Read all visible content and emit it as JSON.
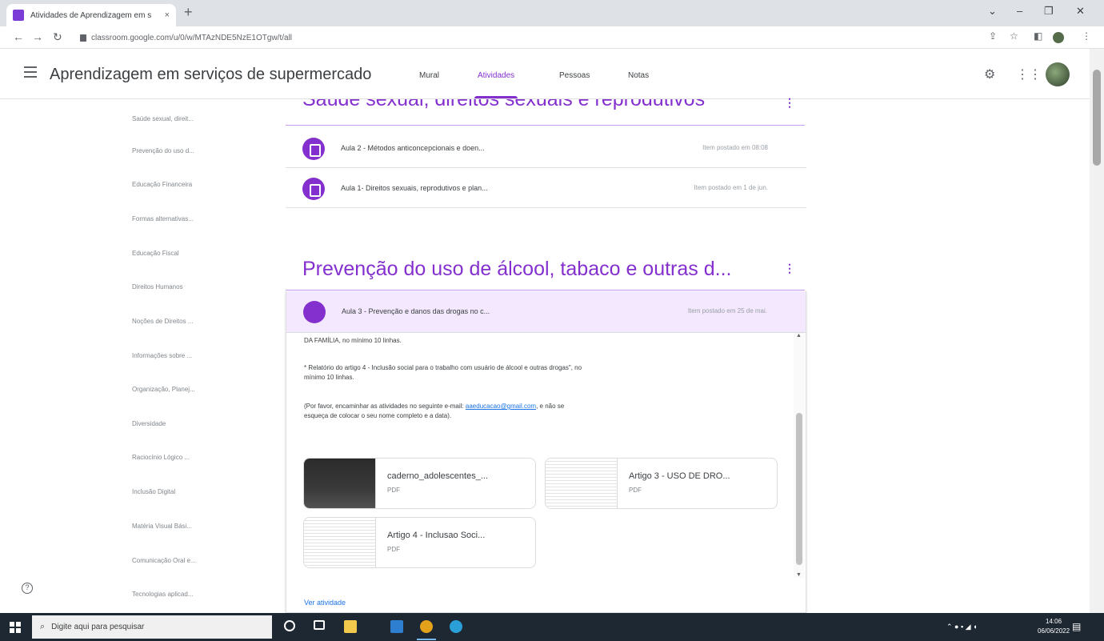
{
  "browser": {
    "tab_title": "Atividades de Aprendizagem em s",
    "tab_close": "×",
    "new_tab": "+",
    "url": "classroom.google.com/u/0/w/MTAzNDE5NzE1OTgw/t/all",
    "window_controls": [
      "⌄",
      "–",
      "❐",
      "✕"
    ]
  },
  "header": {
    "class_name": "Aprendizagem em serviços de supermercado",
    "tabs": [
      "Mural",
      "Atividades",
      "Pessoas",
      "Notas"
    ],
    "active_tab": "Atividades"
  },
  "sidebar": {
    "topics": [
      "Saúde sexual, direit...",
      "Prevenção do uso d...",
      "Educação Financeira",
      "Formas alternativas...",
      "Educação Fiscal",
      "Direitos Humanos",
      "Noções de Direitos ...",
      "Informações sobre ...",
      "Organização, Planej...",
      "Diversidade",
      "Raciocínio Lógico ...",
      "Inclusão Digital",
      "Matéria Visual Bási...",
      "Comunicação Oral e...",
      "Tecnologias aplicad..."
    ]
  },
  "sections": [
    {
      "title": "Saúde sexual, direitos sexuais e reprodutivos",
      "items": [
        {
          "title": "Aula 2 - Métodos anticoncepcionais e doen...",
          "date": "Item postado em 08:08"
        },
        {
          "title": "Aula 1- Direitos sexuais, reprodutivos e plan...",
          "date": "Item postado em 1 de jun."
        }
      ]
    },
    {
      "title": "Prevenção do uso de álcool, tabaco e outras d...",
      "items": [
        {
          "title": "Aula 3 - Prevenção e danos das drogas no c...",
          "date": "Item postado em 25 de mai."
        }
      ]
    }
  ],
  "expanded": {
    "line1": "DA FAMÍLIA, no mínimo 10 linhas.",
    "para2": "* Relatório do artigo 4 - Inclusão social para o trabalho com usuário de álcool e outras drogas\", no mínimo 10 linhas.",
    "para3_pre": "(Por favor, encaminhar as atividades no seguinte e-mail:",
    "email": "aaeducacao@gmail.com",
    "para3_post": ", e não se esqueça de colocar o seu nome completo e a data).",
    "attachments": [
      {
        "name": "caderno_adolescentes_...",
        "type": "PDF"
      },
      {
        "name": "Artigo 3 - USO DE DRO...",
        "type": "PDF"
      },
      {
        "name": "Artigo 4 - Inclusao Soci...",
        "type": "PDF"
      }
    ],
    "view_link": "Ver atividade"
  },
  "taskbar": {
    "search_placeholder": "Digite aqui para pesquisar",
    "time": "14:06",
    "date": "06/06/2022"
  },
  "colors": {
    "accent": "#8430ce",
    "highlight": "#f3e8fd",
    "taskbar": "#1e2833"
  }
}
